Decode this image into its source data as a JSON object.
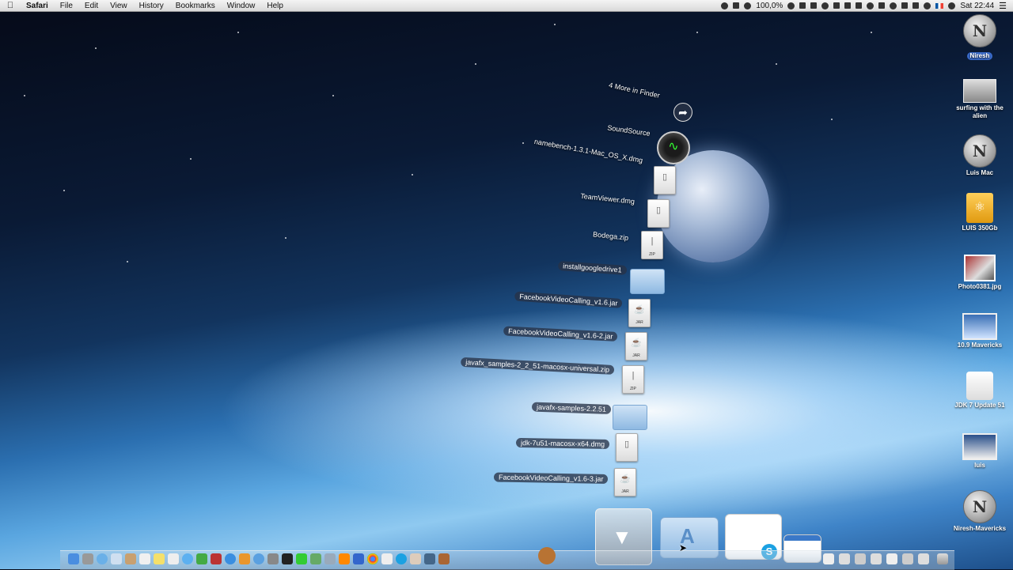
{
  "menubar": {
    "apple": "",
    "app": "Safari",
    "items": [
      "File",
      "Edit",
      "View",
      "History",
      "Bookmarks",
      "Window",
      "Help"
    ],
    "battery": "100,0%",
    "clock": "Sat 22:44"
  },
  "stack": {
    "more_label": "4 More in Finder",
    "items": [
      {
        "label": "SoundSource",
        "kind": "app"
      },
      {
        "label": "namebench-1.3.1-Mac_OS_X.dmg",
        "kind": "dmg"
      },
      {
        "label": "TeamViewer.dmg",
        "kind": "dmg"
      },
      {
        "label": "Bodega.zip",
        "kind": "zip",
        "tag": "ZIP"
      },
      {
        "label": "installgoogledrive1",
        "kind": "folder"
      },
      {
        "label": "FacebookVideoCalling_v1.6.jar",
        "kind": "jar",
        "tag": "JAR"
      },
      {
        "label": "FacebookVideoCalling_v1.6-2.jar",
        "kind": "jar",
        "tag": "JAR"
      },
      {
        "label": "javafx_samples-2_2_51-macosx-universal.zip",
        "kind": "zip",
        "tag": "ZIP"
      },
      {
        "label": "javafx-samples-2.2.51",
        "kind": "folder"
      },
      {
        "label": "jdk-7u51-macosx-x64.dmg",
        "kind": "dmg"
      },
      {
        "label": "FacebookVideoCalling_v1.6-3.jar",
        "kind": "jar",
        "tag": "JAR"
      }
    ]
  },
  "desktop": [
    {
      "label": "Niresh",
      "kind": "disk",
      "selected": true
    },
    {
      "label": "surfing with the alien",
      "kind": "screen"
    },
    {
      "label": "Luis Mac",
      "kind": "disk"
    },
    {
      "label": "LUIS 350Gb",
      "kind": "usb"
    },
    {
      "label": "Photo0381.jpg",
      "kind": "photo"
    },
    {
      "label": "10.9 Mavericks",
      "kind": "screen"
    },
    {
      "label": "JDK 7 Update 51",
      "kind": "blank"
    },
    {
      "label": "luis",
      "kind": "screen"
    },
    {
      "label": "Niresh-Mavericks",
      "kind": "disk"
    }
  ],
  "disk_letter": "N",
  "colors": {
    "accent": "#3a6bc9",
    "dock_folder": "#8eb9e2"
  }
}
